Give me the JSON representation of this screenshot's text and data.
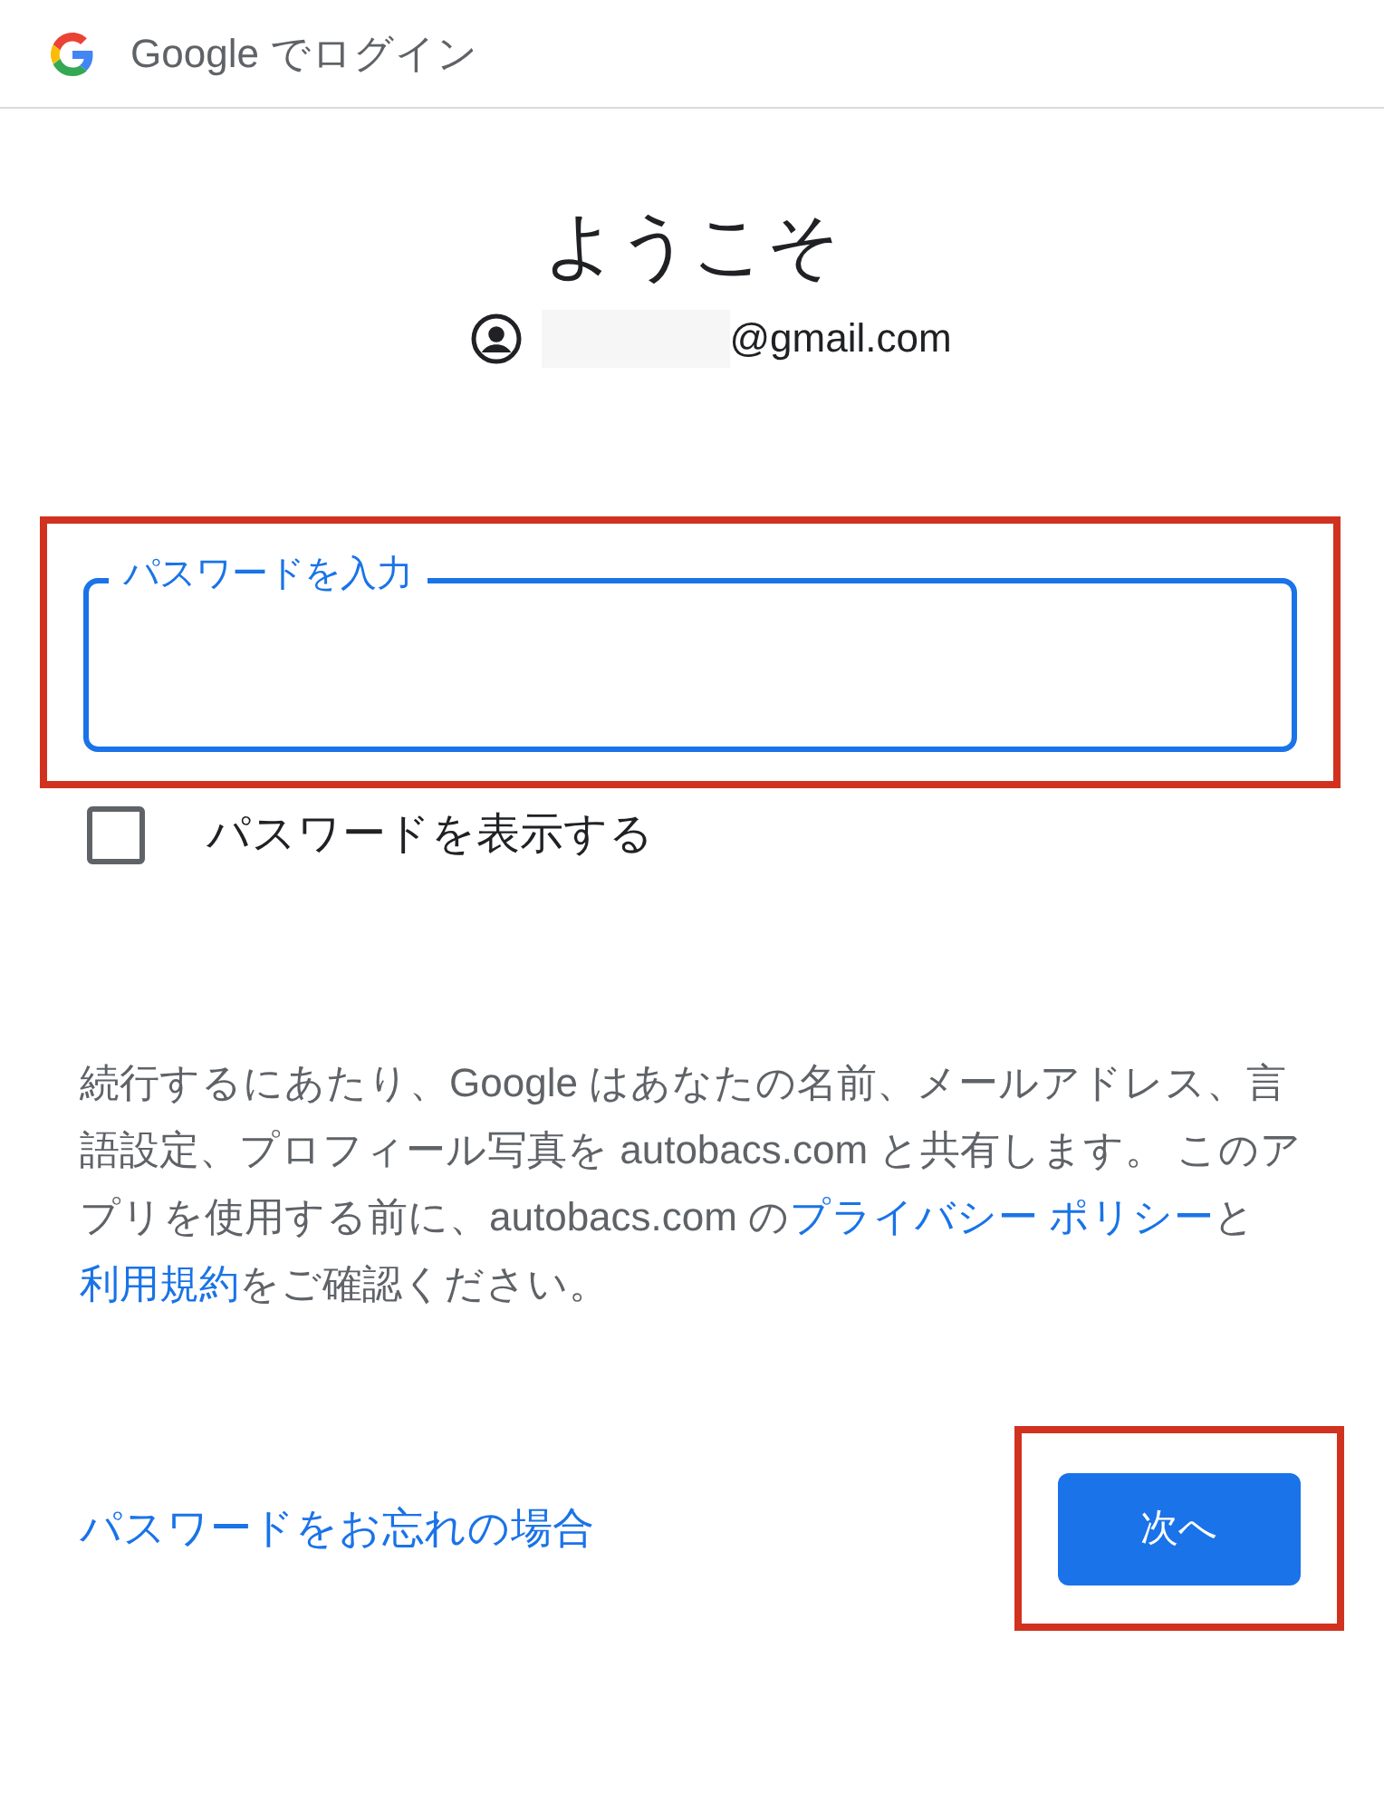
{
  "header": {
    "title": "Google でログイン"
  },
  "heading": "ようこそ",
  "account": {
    "email_visible": "@gmail.com",
    "masked": true
  },
  "password_field": {
    "label": "パスワードを入力",
    "focused": true,
    "highlighted": true
  },
  "show_password": {
    "label": "パスワードを表示する",
    "checked": false
  },
  "notice": [
    {
      "kind": "text",
      "text": "続行するにあたり、Google はあなたの名前、メールアドレス、言語設定、プロフィール写真を autobacs.com と共有します。 このアプリを使用する前に、autobacs.com の"
    },
    {
      "kind": "link",
      "text": "プライバシー ポリシー"
    },
    {
      "kind": "text",
      "text": "と"
    },
    {
      "kind": "link",
      "text": "利用規約"
    },
    {
      "kind": "text",
      "text": "をご確認ください。"
    }
  ],
  "forgot_link": "パスワードをお忘れの場合",
  "next_button": {
    "label": "次へ",
    "highlighted": true
  }
}
